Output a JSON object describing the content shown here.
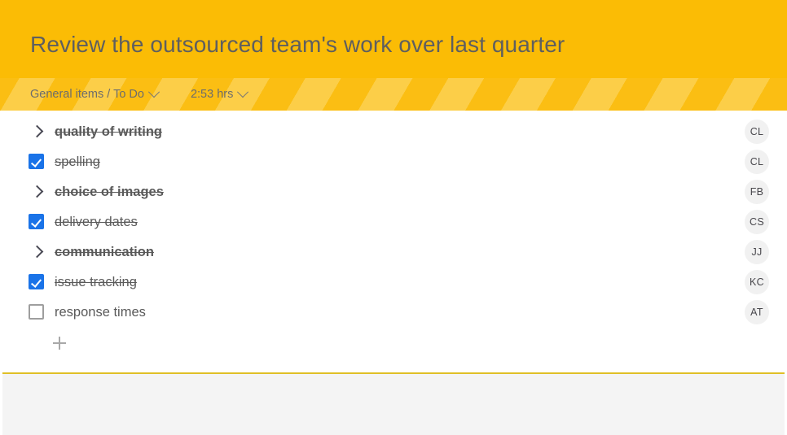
{
  "header": {
    "title": "Review the outsourced team's work over last quarter",
    "background_color": "#FBBC05",
    "title_color": "#5f5f5f"
  },
  "metabar": {
    "breadcrumb": "General items / To Do",
    "breadcrumb_dropdown_icon": "chevron-down-icon",
    "duration": "2:53 hrs",
    "duration_dropdown_icon": "chevron-down-icon",
    "stripe_color_base": "#FBBE13",
    "stripe_color_light": "#FCCE48"
  },
  "checklist": {
    "add_button_icon": "plus-icon",
    "checked_color": "#1a73e8",
    "items": [
      {
        "label": "quality of writing",
        "marker": "chevron-right-icon",
        "marker_type": "chevron",
        "checked": false,
        "struck": true,
        "bold": true,
        "avatar": "CL"
      },
      {
        "label": "spelling",
        "marker": "checkbox-checked-icon",
        "marker_type": "checkbox",
        "checked": true,
        "struck": true,
        "bold": false,
        "avatar": "CL"
      },
      {
        "label": "choice of images",
        "marker": "chevron-right-icon",
        "marker_type": "chevron",
        "checked": false,
        "struck": true,
        "bold": true,
        "avatar": "FB"
      },
      {
        "label": "delivery dates",
        "marker": "checkbox-checked-icon",
        "marker_type": "checkbox",
        "checked": true,
        "struck": true,
        "bold": false,
        "avatar": "CS"
      },
      {
        "label": "communication",
        "marker": "chevron-right-icon",
        "marker_type": "chevron",
        "checked": false,
        "struck": true,
        "bold": true,
        "avatar": "JJ"
      },
      {
        "label": "issue tracking",
        "marker": "checkbox-checked-icon",
        "marker_type": "checkbox",
        "checked": true,
        "struck": true,
        "bold": false,
        "avatar": "KC"
      },
      {
        "label": "response times",
        "marker": "checkbox-unchecked-icon",
        "marker_type": "checkbox",
        "checked": false,
        "struck": false,
        "bold": false,
        "avatar": "AT"
      }
    ]
  },
  "footer": {
    "background_color": "#f4f4f4",
    "divider_color": "#DFBF26"
  }
}
